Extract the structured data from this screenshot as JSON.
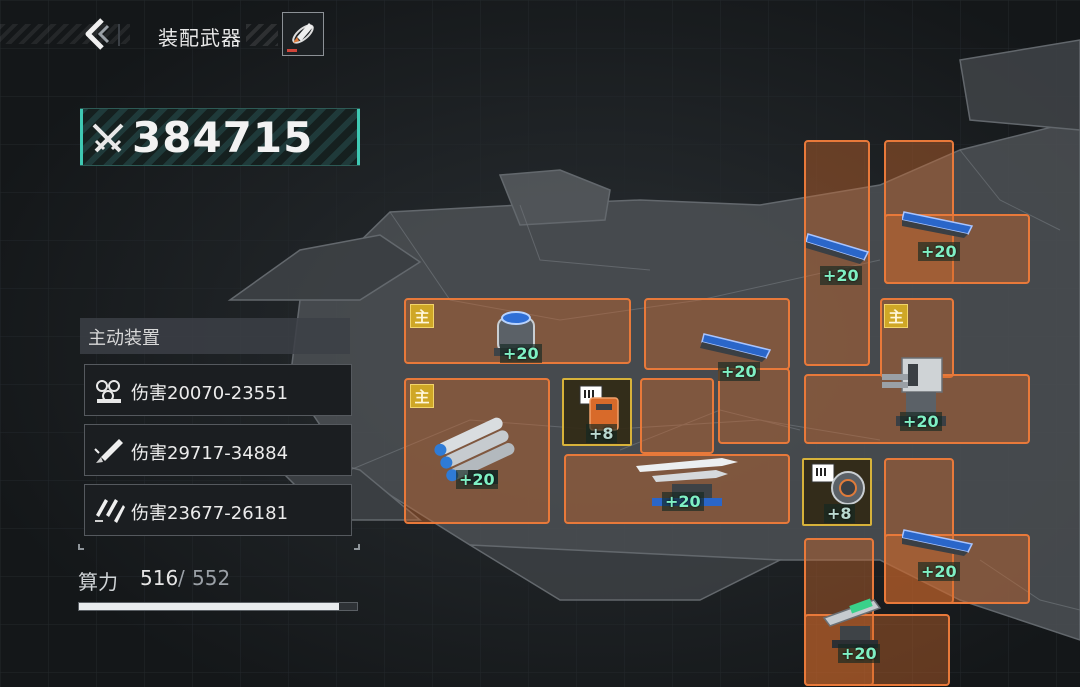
{
  "header": {
    "title": "装配武器"
  },
  "power": {
    "value": "384715"
  },
  "active_equipment": {
    "heading": "主动装置",
    "items": [
      {
        "icon": "drone-swarm-icon",
        "label": "伤害20070-23551"
      },
      {
        "icon": "missile-icon",
        "label": "伤害29717-34884"
      },
      {
        "icon": "multi-missile-icon",
        "label": "伤害23677-26181"
      }
    ]
  },
  "compute": {
    "label": "算力",
    "used": "516",
    "slash": "/",
    "max": "552",
    "fill_fraction": 0.935
  },
  "slots": {
    "main_badge": "主",
    "s1_level": "+20",
    "s2_level": "+20",
    "s3_level": "+20",
    "s4_level": "+8",
    "s5_level": "+20",
    "s6_level": "+20",
    "s7_level": "+20",
    "s8_level": "+20",
    "s9_level": "+8",
    "s10_level": "+20",
    "s11_level": "+20"
  },
  "colors": {
    "slot_orange": "#e8793a",
    "accent_teal": "#3fc9b3",
    "main_badge": "#cfa726",
    "level_text": "#7ff0c4"
  }
}
